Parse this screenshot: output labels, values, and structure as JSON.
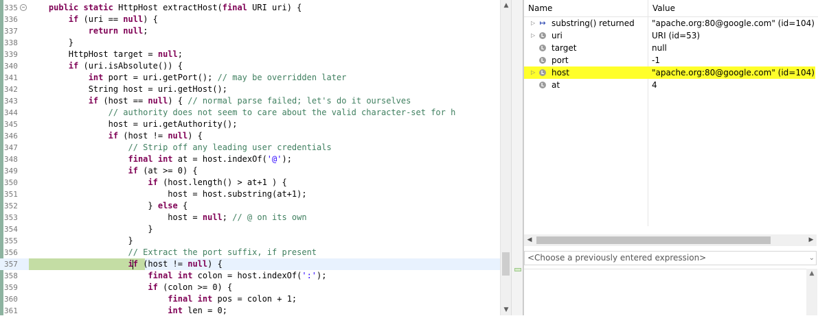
{
  "editor": {
    "lines": [
      {
        "num": "335",
        "fold": true,
        "segments": [
          [
            "    ",
            ""
          ],
          [
            "public static ",
            "kw"
          ],
          [
            "HttpHost extractHost(",
            ""
          ],
          [
            "final ",
            "kw"
          ],
          [
            "URI uri) {",
            ""
          ]
        ]
      },
      {
        "num": "336",
        "segments": [
          [
            "        ",
            ""
          ],
          [
            "if ",
            "kw"
          ],
          [
            "(uri == ",
            ""
          ],
          [
            "null",
            "kw"
          ],
          [
            ") {",
            ""
          ]
        ]
      },
      {
        "num": "337",
        "segments": [
          [
            "            ",
            ""
          ],
          [
            "return null",
            "kw"
          ],
          [
            ";",
            ""
          ]
        ]
      },
      {
        "num": "338",
        "segments": [
          [
            "        }",
            ""
          ]
        ]
      },
      {
        "num": "339",
        "segments": [
          [
            "        HttpHost target = ",
            ""
          ],
          [
            "null",
            "kw"
          ],
          [
            ";",
            ""
          ]
        ]
      },
      {
        "num": "340",
        "segments": [
          [
            "        ",
            ""
          ],
          [
            "if ",
            "kw"
          ],
          [
            "(uri.isAbsolute()) {",
            ""
          ]
        ]
      },
      {
        "num": "341",
        "segments": [
          [
            "            ",
            ""
          ],
          [
            "int ",
            "kw"
          ],
          [
            "port = uri.getPort(); ",
            ""
          ],
          [
            "// may be overridden later",
            "cm"
          ]
        ]
      },
      {
        "num": "342",
        "segments": [
          [
            "            String host = uri.getHost();",
            ""
          ]
        ]
      },
      {
        "num": "343",
        "segments": [
          [
            "            ",
            ""
          ],
          [
            "if ",
            "kw"
          ],
          [
            "(host == ",
            ""
          ],
          [
            "null",
            "kw"
          ],
          [
            ") { ",
            ""
          ],
          [
            "// normal parse failed; let's do it ourselves",
            "cm"
          ]
        ]
      },
      {
        "num": "344",
        "segments": [
          [
            "                ",
            ""
          ],
          [
            "// authority does not seem to care about the valid character-set for h",
            "cm"
          ]
        ]
      },
      {
        "num": "345",
        "segments": [
          [
            "                host = uri.getAuthority();",
            ""
          ]
        ]
      },
      {
        "num": "346",
        "segments": [
          [
            "                ",
            ""
          ],
          [
            "if ",
            "kw"
          ],
          [
            "(host != ",
            ""
          ],
          [
            "null",
            "kw"
          ],
          [
            ") {",
            ""
          ]
        ]
      },
      {
        "num": "347",
        "segments": [
          [
            "                    ",
            ""
          ],
          [
            "// Strip off any leading user credentials",
            "cm"
          ]
        ]
      },
      {
        "num": "348",
        "segments": [
          [
            "                    ",
            ""
          ],
          [
            "final int ",
            "kw"
          ],
          [
            "at = host.indexOf(",
            ""
          ],
          [
            "'@'",
            "str"
          ],
          [
            ");",
            ""
          ]
        ]
      },
      {
        "num": "349",
        "segments": [
          [
            "                    ",
            ""
          ],
          [
            "if ",
            "kw"
          ],
          [
            "(at >= 0) {",
            ""
          ]
        ]
      },
      {
        "num": "350",
        "segments": [
          [
            "                        ",
            ""
          ],
          [
            "if ",
            "kw"
          ],
          [
            "(host.length() > at+1 ) {",
            ""
          ]
        ]
      },
      {
        "num": "351",
        "segments": [
          [
            "                            host = host.substring(at+1);",
            ""
          ]
        ]
      },
      {
        "num": "352",
        "segments": [
          [
            "                        } ",
            ""
          ],
          [
            "else ",
            "kw"
          ],
          [
            "{",
            ""
          ]
        ]
      },
      {
        "num": "353",
        "segments": [
          [
            "                            host = ",
            ""
          ],
          [
            "null",
            "kw"
          ],
          [
            "; ",
            ""
          ],
          [
            "// @ on its own",
            "cm"
          ]
        ]
      },
      {
        "num": "354",
        "segments": [
          [
            "                        }",
            ""
          ]
        ]
      },
      {
        "num": "355",
        "segments": [
          [
            "                    }",
            ""
          ]
        ]
      },
      {
        "num": "356",
        "segments": [
          [
            "                    ",
            ""
          ],
          [
            "// Extract the port suffix, if present",
            "cm"
          ]
        ]
      },
      {
        "num": "357",
        "current": true,
        "caret": true,
        "segments": [
          [
            "                    ",
            ""
          ],
          [
            "if ",
            "kw"
          ],
          [
            "(host != ",
            ""
          ],
          [
            "null",
            "kw"
          ],
          [
            ") {",
            ""
          ]
        ]
      },
      {
        "num": "358",
        "segments": [
          [
            "                        ",
            ""
          ],
          [
            "final int ",
            "kw"
          ],
          [
            "colon = host.indexOf(",
            ""
          ],
          [
            "':'",
            "str"
          ],
          [
            ");",
            ""
          ]
        ]
      },
      {
        "num": "359",
        "segments": [
          [
            "                        ",
            ""
          ],
          [
            "if ",
            "kw"
          ],
          [
            "(colon >= 0) {",
            ""
          ]
        ]
      },
      {
        "num": "360",
        "segments": [
          [
            "                            ",
            ""
          ],
          [
            "final int ",
            "kw"
          ],
          [
            "pos = colon + 1;",
            ""
          ]
        ]
      },
      {
        "num": "361",
        "segments": [
          [
            "                            ",
            ""
          ],
          [
            "int ",
            "kw"
          ],
          [
            "len = 0;",
            ""
          ]
        ]
      }
    ]
  },
  "variables": {
    "col_name": "Name",
    "col_value": "Value",
    "rows": [
      {
        "name": "substring() returned",
        "value": "\"apache.org:80@google.com\" (id=104)",
        "expandable": true,
        "icon": "return-value-icon"
      },
      {
        "name": "uri",
        "value": "URI  (id=53)",
        "expandable": true,
        "icon": "local-variable-icon"
      },
      {
        "name": "target",
        "value": "null",
        "expandable": false,
        "icon": "local-variable-icon"
      },
      {
        "name": "port",
        "value": "-1",
        "expandable": false,
        "icon": "local-variable-icon"
      },
      {
        "name": "host",
        "value": "\"apache.org:80@google.com\" (id=104)",
        "expandable": true,
        "icon": "local-variable-icon",
        "selected": true
      },
      {
        "name": "at",
        "value": "4",
        "expandable": false,
        "icon": "local-variable-icon"
      }
    ],
    "expression_placeholder": "<Choose a previously entered expression>"
  },
  "colors": {
    "keyword": "#7f0055",
    "comment": "#3f7f5f",
    "string": "#2a00ff",
    "execution_highlight": "#c4dda4",
    "selected_row": "#ffff2a"
  }
}
